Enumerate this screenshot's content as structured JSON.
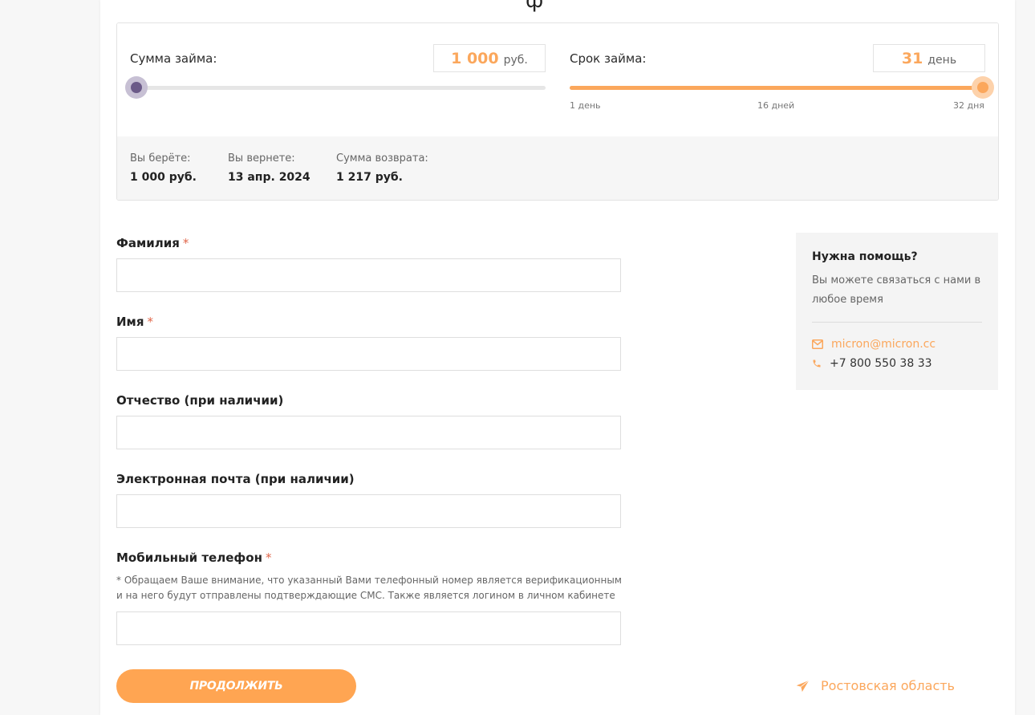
{
  "page": {
    "title_fragment": "ф"
  },
  "calculator": {
    "amount_label": "Сумма займа:",
    "amount_value": "1 000",
    "amount_unit": "руб.",
    "amount_fraction": 0.0,
    "term_label": "Срок займа:",
    "term_value": "31",
    "term_unit": "день",
    "term_fraction": 1.0,
    "term_ticks": [
      "1 день",
      "16 дней",
      "32 дня"
    ],
    "summary": [
      {
        "label": "Вы берёте:",
        "value": "1 000 руб."
      },
      {
        "label": "Вы вернете:",
        "value": "13 апр. 2024"
      },
      {
        "label": "Сумма возврата:",
        "value": "1 217 руб."
      }
    ]
  },
  "form": {
    "last_name_label": "Фамилия",
    "first_name_label": "Имя",
    "patronymic_label": "Отчество (при наличии)",
    "email_label": "Электронная почта (при наличии)",
    "phone_label": "Мобильный телефон",
    "required_mark": "*",
    "phone_note": "* Обращаем Ваше внимание, что указанный Вами телефонный номер является верификационным и на него будут отправлены подтверждающие СМС. Также является логином в личном кабинете",
    "last_name_value": "",
    "first_name_value": "",
    "patronymic_value": "",
    "email_value": "",
    "phone_value": "",
    "submit_label": "ПРОДОЛЖИТЬ"
  },
  "help": {
    "title": "Нужна помощь?",
    "text": "Вы можете связаться с нами в любое время",
    "email": "micron@micron.cc",
    "phone": "+7 800 550 38 33"
  },
  "region": {
    "label": "Ростовская область"
  },
  "colors": {
    "accent": "#fba75c",
    "button": "#ffa552",
    "amount_knob": "#6b5a88"
  }
}
